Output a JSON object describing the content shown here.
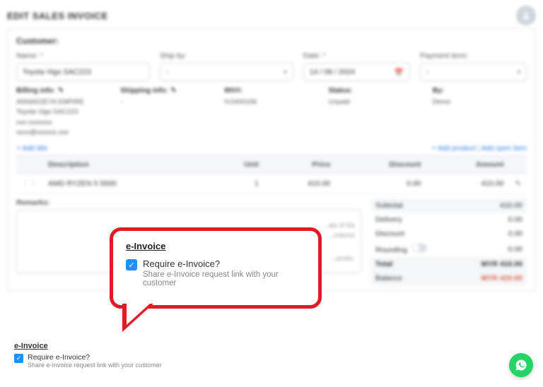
{
  "page_title": "EDIT SALES INVOICE",
  "customer_section_title": "Customer:",
  "fields": {
    "name_label": "Name:",
    "name_value": "Toyota Vigo SAC223",
    "ship_label": "Ship by:",
    "ship_value": "-",
    "date_label": "Date:",
    "date_value": "14 / 08 / 2024",
    "payment_label": "Payment term:",
    "payment_value": "-"
  },
  "info": {
    "billing_label": "Billing info:",
    "billing_lines": "ANNADZEYA EMPIRE\nToyota Vigo SAC223\nxxx-xxxxxxx\nxxxx@xxxxxx.xxx",
    "shipping_label": "Shipping info:",
    "shipping_value": "-",
    "inv_label": "INV#:",
    "inv_value": "IV2400156",
    "status_label": "Status:",
    "status_value": "Unpaid",
    "by_label": "By:",
    "by_value": "Demo"
  },
  "links": {
    "add_title": "+ Add title",
    "add_product": "+ Add product",
    "add_open_item": "Add open item"
  },
  "table": {
    "headers": {
      "description": "Description",
      "unit": "Unit",
      "price": "Price",
      "discount": "Discount",
      "amount": "Amount"
    },
    "row": {
      "description": "AMD RYZEN 5 5500",
      "unit": "1",
      "price": "410.00",
      "discount": "0.00",
      "amount": "410.00"
    }
  },
  "remarks_label": "Remarks:",
  "remarks_hint_r1": "…ate of the",
  "remarks_hint_r2": "…interest",
  "remarks_hint_r3": "…ansfer.",
  "totals": {
    "subtotal_label": "Subtotal",
    "subtotal": "410.00",
    "delivery_label": "Delivery",
    "delivery": "0.00",
    "discount_label": "Discount",
    "discount": "0.00",
    "rounding_label": "Rounding",
    "rounding": "0.00",
    "total_label": "Total",
    "total": "MYR 410.00",
    "balance_label": "Balance",
    "balance": "MYR 410.00"
  },
  "einvoice": {
    "title": "e-Invoice",
    "question": "Require e-Invoice?",
    "subtext": "Share e-Invoice request link with your customer"
  }
}
